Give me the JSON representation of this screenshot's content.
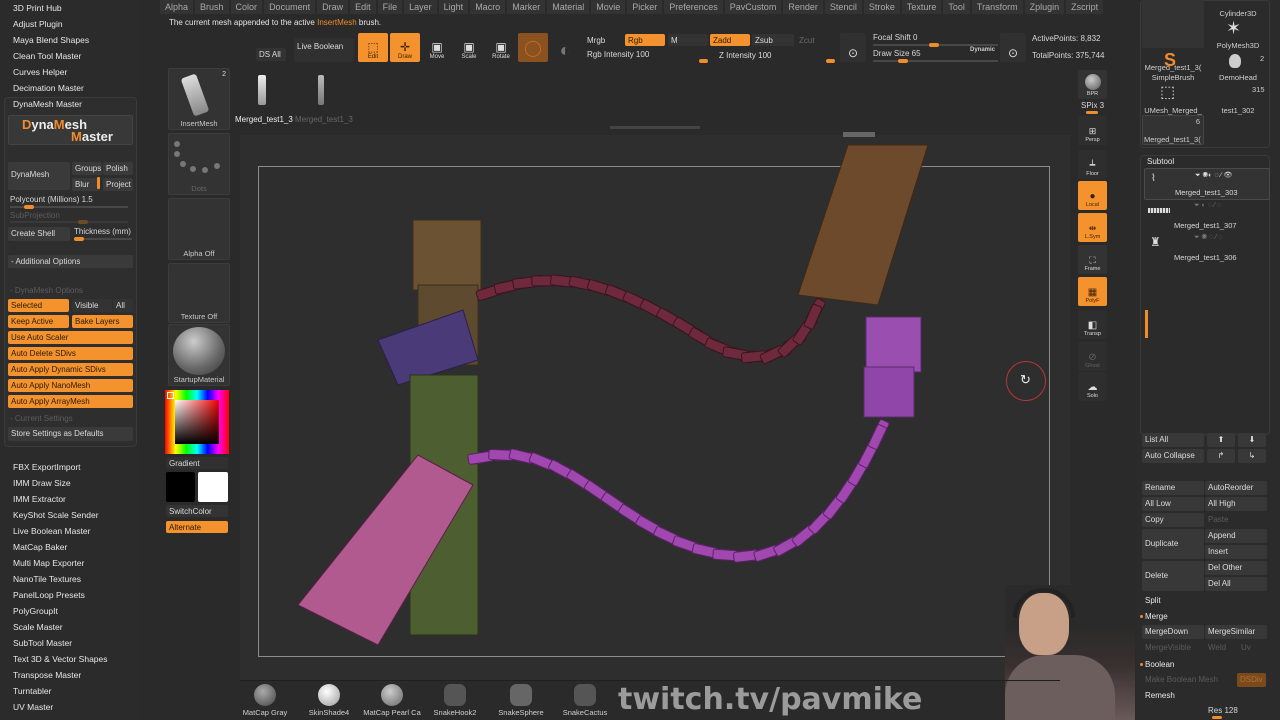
{
  "menubar": [
    "Alpha",
    "Brush",
    "Color",
    "Document",
    "Draw",
    "Edit",
    "File",
    "Layer",
    "Light",
    "Macro",
    "Marker",
    "Material",
    "Movie",
    "Picker",
    "Preferences",
    "PavCustom",
    "Render",
    "Stencil",
    "Stroke",
    "Texture",
    "Tool",
    "Transform",
    "Zplugin",
    "Zscript"
  ],
  "status": {
    "prefix": "The current mesh appended to the active ",
    "highlight": "InsertMesh",
    "suffix": " brush."
  },
  "plugins_top": [
    "3D Print Hub",
    "Adjust Plugin",
    "Maya Blend Shapes",
    "Clean Tool Master",
    "Curves Helper",
    "Decimation Master",
    "DynaMesh Master"
  ],
  "dynamesh": {
    "logo_line1_a": "D",
    "logo_line1_b": "yna",
    "logo_line1_c": "M",
    "logo_line1_d": "esh",
    "logo_line2_a": "M",
    "logo_line2_b": "aster",
    "dynamesh_btn": "DynaMesh",
    "groups": "Groups",
    "polish": "Polish",
    "blur": "Blur",
    "project": "Project",
    "polycount_label": "Polycount (Millions) 1.5",
    "polycount_value": 1.5,
    "subprojection": "SubProjection",
    "create_shell": "Create Shell",
    "thickness": "Thickness (mm)",
    "additional_options": "- Additional Options",
    "options_header": "- DynaMesh Options",
    "selected": "Selected",
    "visible": "Visible",
    "all": "All",
    "keep_active": "Keep Active",
    "bake_layers": "Bake Layers",
    "use_auto_scaler": "Use Auto Scaler",
    "auto_delete_sdivs": "Auto Delete SDivs",
    "auto_apply_dynamic": "Auto Apply Dynamic SDivs",
    "auto_apply_nanomesh": "Auto Apply NanoMesh",
    "auto_apply_arraymesh": "Auto Apply ArrayMesh",
    "current_settings": "- Current Settings",
    "store_defaults": "Store Settings as Defaults"
  },
  "plugins_bottom": [
    "FBX ExportImport",
    "IMM Draw Size",
    "IMM Extractor",
    "KeyShot Scale Sender",
    "Live Boolean Master",
    "MatCap Baker",
    "Multi Map Exporter",
    "NanoTile Textures",
    "PanelLoop Presets",
    "PolyGroupIt",
    "Scale Master",
    "SubTool Master",
    "Text 3D & Vector Shapes",
    "Transpose Master",
    "Turntabler",
    "UV Master"
  ],
  "toolbar": {
    "ds_all": "DS All",
    "live_boolean": "Live Boolean",
    "edit": "Edit",
    "draw": "Draw",
    "move": "Move",
    "scale": "Scale",
    "rotate": "Rotate",
    "mrgb": "Mrgb",
    "rgb": "Rgb",
    "m": "M",
    "zadd": "Zadd",
    "zsub": "Zsub",
    "zcut": "Zcut",
    "rgb_intensity": "Rgb Intensity 100",
    "z_intensity": "Z Intensity 100",
    "focal_shift": "Focal Shift 0",
    "draw_size": "Draw Size 65",
    "dynamic": "Dynamic",
    "active_points": "ActivePoints: 8,832",
    "total_points": "TotalPoints: 375,744"
  },
  "tool_strip": {
    "insertmesh": "InsertMesh",
    "insertmesh_count": "2",
    "recent1": "Merged_test1_3",
    "recent2": "Merged_test1_3",
    "dots": "Dots",
    "alpha_off": "Alpha Off",
    "texture_off": "Texture Off",
    "material": "StartupMaterial",
    "gradient": "Gradient",
    "switch_color": "SwitchColor",
    "alternate": "Alternate"
  },
  "right_tools": [
    "BPR",
    "SPix 3",
    "Persp",
    "Floor",
    "Local",
    "L.Sym",
    "Frame",
    "PolyF",
    "Transp",
    "Ghost",
    "Solo"
  ],
  "right_panel": {
    "thumbs": [
      {
        "label": "Merged_test1_3(",
        "count": ""
      },
      {
        "label": "Cylinder3D",
        "count": ""
      },
      {
        "label": "PolyMesh3D",
        "count": ""
      },
      {
        "label": "SimpleBrush",
        "count": ""
      },
      {
        "label": "DemoHead",
        "count": "2"
      },
      {
        "label": "UMesh_Merged_",
        "count": ""
      },
      {
        "label": "test1_302",
        "count": "315"
      },
      {
        "label": "Merged_test1_3(",
        "count": "6"
      }
    ],
    "subtool_header": "Subtool",
    "subtools": [
      "Merged_test1_303",
      "Merged_test1_307",
      "Merged_test1_306"
    ],
    "list_all": "List All",
    "auto_collapse": "Auto Collapse",
    "rename": "Rename",
    "auto_reorder": "AutoReorder",
    "all_low": "All Low",
    "all_high": "All High",
    "copy": "Copy",
    "paste": "Paste",
    "duplicate": "Duplicate",
    "append": "Append",
    "insert": "Insert",
    "delete": "Delete",
    "del_other": "Del Other",
    "del_all": "Del All",
    "split": "Split",
    "merge": "Merge",
    "merge_down": "MergeDown",
    "merge_similar": "MergeSimilar",
    "merge_visible": "MergeVisible",
    "weld": "Weld",
    "uv": "Uv",
    "boolean": "Boolean",
    "make_boolean": "Make Boolean Mesh",
    "dsdiv": "DSDiv",
    "remesh": "Remesh",
    "res": "Res 128"
  },
  "shelf": [
    "MatCap Gray",
    "SkinShade4",
    "MatCap Pearl Ca",
    "SnakeHook2",
    "SnakeSphere",
    "SnakeCactus"
  ],
  "watermark": "twitch.tv/pavmike",
  "colors": {
    "accent": "#f4922d",
    "bg": "#2a2a2a"
  }
}
